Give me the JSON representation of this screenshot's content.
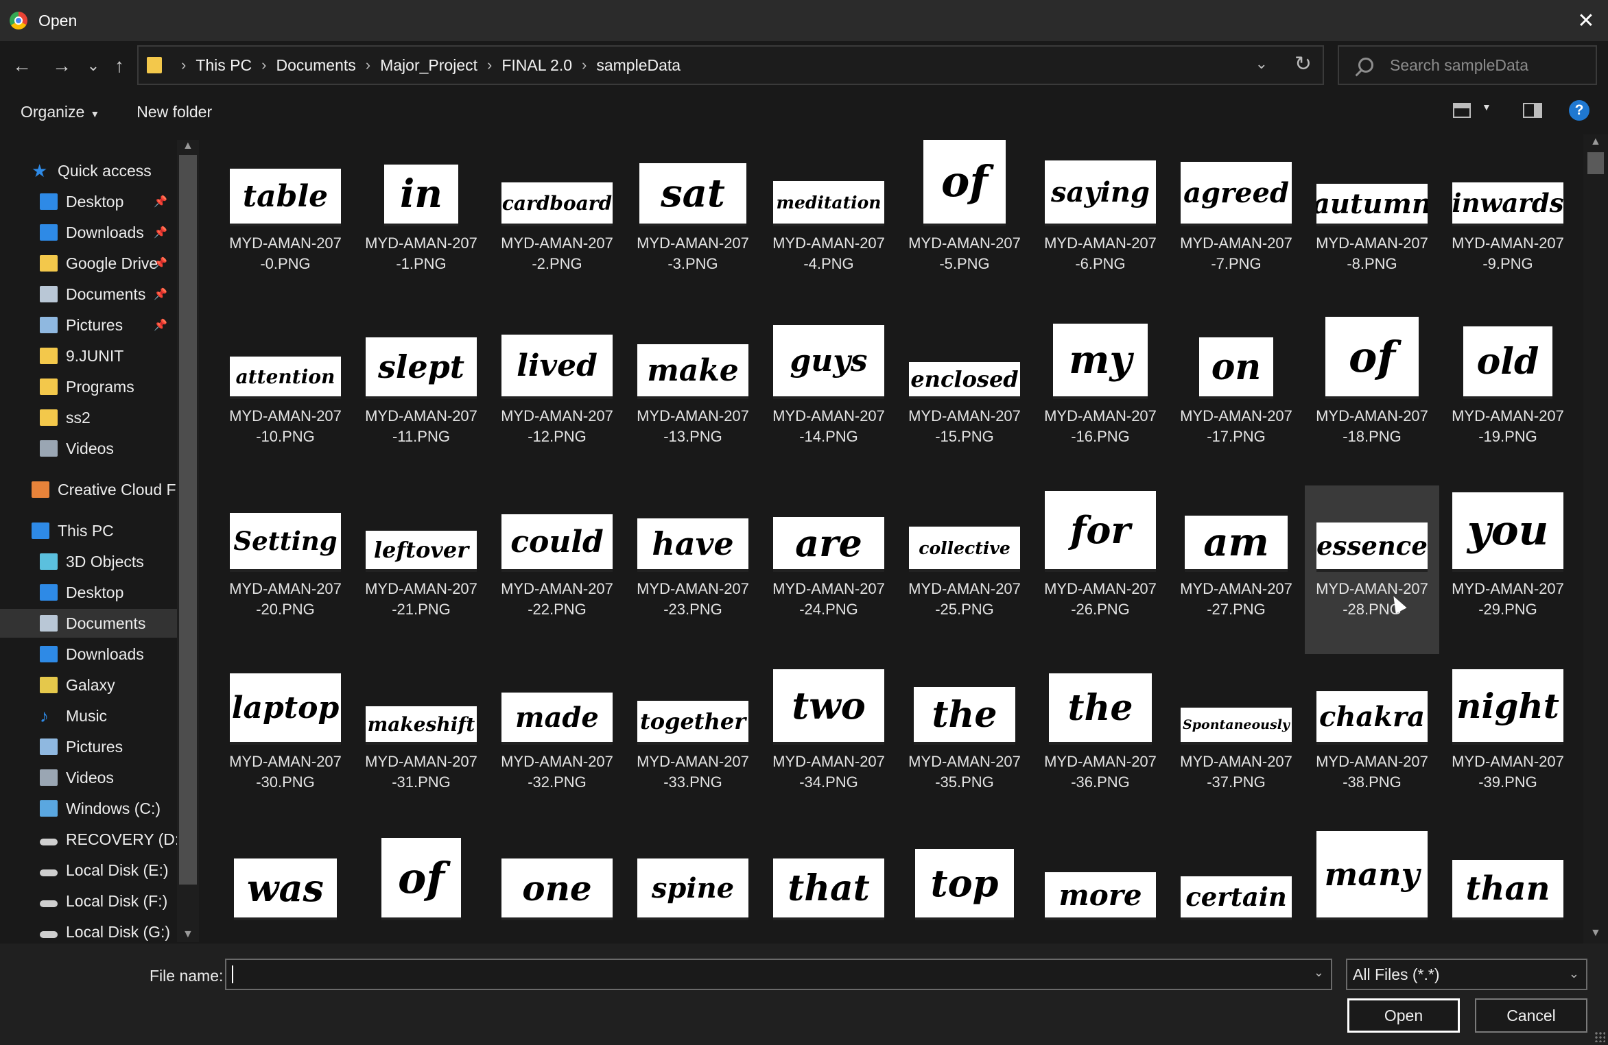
{
  "window": {
    "title": "Open",
    "close_glyph": "✕"
  },
  "nav_buttons": {
    "back": "←",
    "forward": "→",
    "recent": "⌄",
    "up": "↑"
  },
  "breadcrumbs": [
    "This PC",
    "Documents",
    "Major_Project",
    "FINAL 2.0",
    "sampleData"
  ],
  "search": {
    "placeholder": "Search sampleData"
  },
  "toolbar": {
    "organize_label": "Organize",
    "new_folder_label": "New folder",
    "help_glyph": "?"
  },
  "sidebar": {
    "items": [
      {
        "label": "Quick access",
        "icon": "star-icon",
        "color": "#2e8ae6",
        "pinned": false,
        "indent": 1
      },
      {
        "label": "Desktop",
        "icon": "desktop-icon",
        "color": "#2e8ae6",
        "pinned": true,
        "indent": 2
      },
      {
        "label": "Downloads",
        "icon": "download-icon",
        "color": "#2e8ae6",
        "pinned": true,
        "indent": 2
      },
      {
        "label": "Google Drive",
        "icon": "drive-icon",
        "color": "#f3c84b",
        "pinned": true,
        "indent": 2
      },
      {
        "label": "Documents",
        "icon": "documents-icon",
        "color": "#b9c7d6",
        "pinned": true,
        "indent": 2
      },
      {
        "label": "Pictures",
        "icon": "pictures-icon",
        "color": "#8fb8e0",
        "pinned": true,
        "indent": 2
      },
      {
        "label": "9.JUNIT",
        "icon": "folder-icon",
        "color": "#f3c84b",
        "pinned": false,
        "indent": 2
      },
      {
        "label": "Programs",
        "icon": "folder-icon",
        "color": "#f3c84b",
        "pinned": false,
        "indent": 2
      },
      {
        "label": "ss2",
        "icon": "folder-icon",
        "color": "#f3c84b",
        "pinned": false,
        "indent": 2
      },
      {
        "label": "Videos",
        "icon": "videos-icon",
        "color": "#9aa6b3",
        "pinned": false,
        "indent": 2
      },
      {
        "label": "Creative Cloud Files",
        "icon": "creative-cloud-icon",
        "color": "#e8833a",
        "pinned": false,
        "indent": 1
      },
      {
        "label": "This PC",
        "icon": "this-pc-icon",
        "color": "#2e8ae6",
        "pinned": false,
        "indent": 1
      },
      {
        "label": "3D Objects",
        "icon": "3d-objects-icon",
        "color": "#5bc0de",
        "pinned": false,
        "indent": 2
      },
      {
        "label": "Desktop",
        "icon": "desktop-icon",
        "color": "#2e8ae6",
        "pinned": false,
        "indent": 2
      },
      {
        "label": "Documents",
        "icon": "documents-icon",
        "color": "#b9c7d6",
        "pinned": false,
        "indent": 2,
        "selected": true
      },
      {
        "label": "Downloads",
        "icon": "download-icon",
        "color": "#2e8ae6",
        "pinned": false,
        "indent": 2
      },
      {
        "label": "Galaxy",
        "icon": "device-icon",
        "color": "#e5c84b",
        "pinned": false,
        "indent": 2
      },
      {
        "label": "Music",
        "icon": "music-icon",
        "color": "#2e8ae6",
        "pinned": false,
        "indent": 2
      },
      {
        "label": "Pictures",
        "icon": "pictures-icon",
        "color": "#8fb8e0",
        "pinned": false,
        "indent": 2
      },
      {
        "label": "Videos",
        "icon": "videos-icon",
        "color": "#9aa6b3",
        "pinned": false,
        "indent": 2
      },
      {
        "label": "Windows (C:)",
        "icon": "drive-c-icon",
        "color": "#5aa7e0",
        "pinned": false,
        "indent": 2
      },
      {
        "label": "RECOVERY (D:)",
        "icon": "disk-icon",
        "color": "#cfcfcf",
        "pinned": false,
        "indent": 2
      },
      {
        "label": "Local Disk (E:)",
        "icon": "disk-icon",
        "color": "#cfcfcf",
        "pinned": false,
        "indent": 2
      },
      {
        "label": "Local Disk (F:)",
        "icon": "disk-icon",
        "color": "#cfcfcf",
        "pinned": false,
        "indent": 2
      },
      {
        "label": "Local Disk (G:)",
        "icon": "disk-icon",
        "color": "#cfcfcf",
        "pinned": false,
        "indent": 2
      }
    ]
  },
  "files": [
    {
      "word": "table",
      "name": [
        "MYD-AMAN-207",
        "-0.PNG"
      ]
    },
    {
      "word": "in",
      "name": [
        "MYD-AMAN-207",
        "-1.PNG"
      ]
    },
    {
      "word": "cardboard",
      "name": [
        "MYD-AMAN-207",
        "-2.PNG"
      ]
    },
    {
      "word": "sat",
      "name": [
        "MYD-AMAN-207",
        "-3.PNG"
      ]
    },
    {
      "word": "meditation",
      "name": [
        "MYD-AMAN-207",
        "-4.PNG"
      ]
    },
    {
      "word": "of",
      "name": [
        "MYD-AMAN-207",
        "-5.PNG"
      ]
    },
    {
      "word": "saying",
      "name": [
        "MYD-AMAN-207",
        "-6.PNG"
      ]
    },
    {
      "word": "agreed",
      "name": [
        "MYD-AMAN-207",
        "-7.PNG"
      ]
    },
    {
      "word": "autumn",
      "name": [
        "MYD-AMAN-207",
        "-8.PNG"
      ]
    },
    {
      "word": "inwards",
      "name": [
        "MYD-AMAN-207",
        "-9.PNG"
      ]
    },
    {
      "word": "attention",
      "name": [
        "MYD-AMAN-207",
        "-10.PNG"
      ]
    },
    {
      "word": "slept",
      "name": [
        "MYD-AMAN-207",
        "-11.PNG"
      ]
    },
    {
      "word": "lived",
      "name": [
        "MYD-AMAN-207",
        "-12.PNG"
      ]
    },
    {
      "word": "make",
      "name": [
        "MYD-AMAN-207",
        "-13.PNG"
      ]
    },
    {
      "word": "guys",
      "name": [
        "MYD-AMAN-207",
        "-14.PNG"
      ]
    },
    {
      "word": "enclosed",
      "name": [
        "MYD-AMAN-207",
        "-15.PNG"
      ]
    },
    {
      "word": "my",
      "name": [
        "MYD-AMAN-207",
        "-16.PNG"
      ]
    },
    {
      "word": "on",
      "name": [
        "MYD-AMAN-207",
        "-17.PNG"
      ]
    },
    {
      "word": "of",
      "name": [
        "MYD-AMAN-207",
        "-18.PNG"
      ]
    },
    {
      "word": "old",
      "name": [
        "MYD-AMAN-207",
        "-19.PNG"
      ]
    },
    {
      "word": "Setting",
      "name": [
        "MYD-AMAN-207",
        "-20.PNG"
      ]
    },
    {
      "word": "leftover",
      "name": [
        "MYD-AMAN-207",
        "-21.PNG"
      ]
    },
    {
      "word": "could",
      "name": [
        "MYD-AMAN-207",
        "-22.PNG"
      ]
    },
    {
      "word": "have",
      "name": [
        "MYD-AMAN-207",
        "-23.PNG"
      ]
    },
    {
      "word": "are",
      "name": [
        "MYD-AMAN-207",
        "-24.PNG"
      ]
    },
    {
      "word": "collective",
      "name": [
        "MYD-AMAN-207",
        "-25.PNG"
      ]
    },
    {
      "word": "for",
      "name": [
        "MYD-AMAN-207",
        "-26.PNG"
      ]
    },
    {
      "word": "am",
      "name": [
        "MYD-AMAN-207",
        "-27.PNG"
      ]
    },
    {
      "word": "essence",
      "name": [
        "MYD-AMAN-207",
        "-28.PNG"
      ],
      "selected": true
    },
    {
      "word": "you",
      "name": [
        "MYD-AMAN-207",
        "-29.PNG"
      ]
    },
    {
      "word": "laptop",
      "name": [
        "MYD-AMAN-207",
        "-30.PNG"
      ]
    },
    {
      "word": "makeshift",
      "name": [
        "MYD-AMAN-207",
        "-31.PNG"
      ]
    },
    {
      "word": "made",
      "name": [
        "MYD-AMAN-207",
        "-32.PNG"
      ]
    },
    {
      "word": "together",
      "name": [
        "MYD-AMAN-207",
        "-33.PNG"
      ]
    },
    {
      "word": "two",
      "name": [
        "MYD-AMAN-207",
        "-34.PNG"
      ]
    },
    {
      "word": "the",
      "name": [
        "MYD-AMAN-207",
        "-35.PNG"
      ]
    },
    {
      "word": "the",
      "name": [
        "MYD-AMAN-207",
        "-36.PNG"
      ]
    },
    {
      "word": "Spontaneously",
      "name": [
        "MYD-AMAN-207",
        "-37.PNG"
      ]
    },
    {
      "word": "chakra",
      "name": [
        "MYD-AMAN-207",
        "-38.PNG"
      ]
    },
    {
      "word": "night",
      "name": [
        "MYD-AMAN-207",
        "-39.PNG"
      ]
    },
    {
      "word": "was",
      "name": []
    },
    {
      "word": "of",
      "name": []
    },
    {
      "word": "one",
      "name": []
    },
    {
      "word": "spine",
      "name": []
    },
    {
      "word": "that",
      "name": []
    },
    {
      "word": "top",
      "name": []
    },
    {
      "word": "more",
      "name": []
    },
    {
      "word": "certain",
      "name": []
    },
    {
      "word": "many",
      "name": []
    },
    {
      "word": "than",
      "name": []
    }
  ],
  "footer": {
    "file_name_label": "File name:",
    "file_name_value": "",
    "filter_value": "All Files (*.*)",
    "open_label": "Open",
    "cancel_label": "Cancel"
  }
}
